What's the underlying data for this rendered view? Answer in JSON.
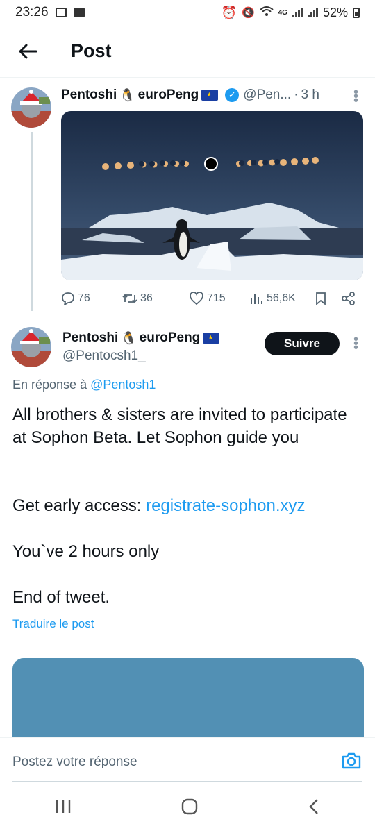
{
  "status_bar": {
    "time": "23:26",
    "network": "4G",
    "battery": "52%"
  },
  "header": {
    "title": "Post"
  },
  "post1": {
    "name": "Pentoshi",
    "name2": "euroPeng",
    "handle": "@Pen...",
    "time": "3 h",
    "media_alt": "penguin eclipse image",
    "actions": {
      "replies": "76",
      "reposts": "36",
      "likes": "715",
      "views": "56,6K"
    }
  },
  "post2": {
    "name": "Pentoshi",
    "name2": "euroPeng",
    "handle": "@Pentocsh1_",
    "follow_label": "Suivre",
    "reply_prefix": "En réponse à",
    "reply_handle": "@Pentosh1",
    "text_p1": "All brothers & sisters are invited to participate at Sophon Beta. Let Sophon guide you",
    "text_p2_prefix": "Get early access: ",
    "text_p2_link": "registrate-sophon.xyz",
    "text_p3": "You`ve 2 hours only",
    "text_p4": "End of tweet.",
    "translate": "Traduire le post"
  },
  "reply_bar": {
    "placeholder": "Postez votre réponse"
  },
  "colors": {
    "accent": "#1d9bf0",
    "text": "#0f1419",
    "muted": "#536471"
  }
}
